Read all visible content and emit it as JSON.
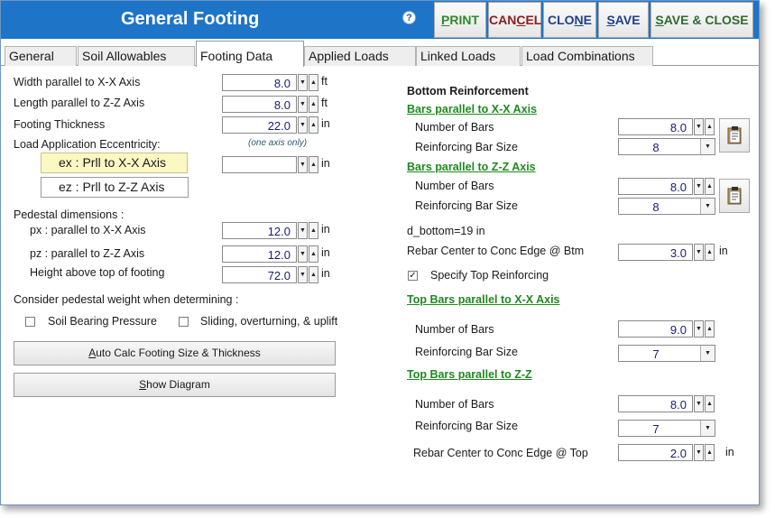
{
  "window": {
    "title": "General Footing",
    "help_glyph": "?",
    "buttons": {
      "print": {
        "pre": "",
        "u": "P",
        "post": "RINT"
      },
      "cancel": {
        "pre": "CAN",
        "u": "C",
        "post": "EL"
      },
      "clone": {
        "pre": "CLO",
        "u": "N",
        "post": "E"
      },
      "save": {
        "pre": "",
        "u": "S",
        "post": "AVE"
      },
      "save_close": {
        "pre": "",
        "u": "S",
        "post": "AVE & CLOSE"
      }
    }
  },
  "tabs": [
    "General",
    "Soil Allowables",
    "Footing Data",
    "Applied Loads",
    "Linked Loads",
    "Load Combinations"
  ],
  "left": {
    "width_label": "Width parallel to X-X Axis",
    "width_value": "8.0",
    "width_unit": "ft",
    "length_label": "Length parallel to Z-Z Axis",
    "length_value": "8.0",
    "length_unit": "ft",
    "thickness_label": "Footing Thickness",
    "thickness_value": "22.0",
    "thickness_unit": "in",
    "ecc_label": "Load Application Eccentricity:",
    "ecc_hint": "(one axis only)",
    "ex_button": "ex : Prll to X-X Axis",
    "ez_button": "ez : Prll to Z-Z Axis",
    "ecc_value": "",
    "ecc_unit": "in",
    "pedestal_label": "Pedestal dimensions :",
    "px_label": "px : parallel to X-X Axis",
    "px_value": "12.0",
    "px_unit": "in",
    "pz_label": "pz : parallel to Z-Z Axis",
    "pz_value": "12.0",
    "pz_unit": "in",
    "height_label": "Height above top of footing",
    "height_value": "72.0",
    "height_unit": "in",
    "ped_weight_label": "Consider pedestal weight when determining :",
    "soil_bearing_label": "Soil Bearing Pressure",
    "sliding_label": "Sliding, overturning, & uplift",
    "auto_calc": {
      "u": "A",
      "rest": "uto Calc Footing Size & Thickness"
    },
    "show_diagram": {
      "u": "S",
      "rest": "how Diagram"
    }
  },
  "right": {
    "bottom_title": "Bottom Reinforcement",
    "bars_x_title": "Bars parallel to X-X Axis",
    "bars_x_num_label": "Number of Bars",
    "bars_x_num_value": "8.0",
    "bars_x_size_label": "Reinforcing Bar Size",
    "bars_x_size_value": "8",
    "bars_z_title": "Bars parallel to Z-Z Axis",
    "bars_z_num_label": "Number of Bars",
    "bars_z_num_value": "8.0",
    "bars_z_size_label": "Reinforcing Bar Size",
    "bars_z_size_value": "8",
    "d_bottom": "d_bottom=19 in",
    "rebar_btm_label": "Rebar Center to Conc Edge @ Btm",
    "rebar_btm_value": "3.0",
    "rebar_btm_unit": "in",
    "specify_top_label": "Specify Top Reinforcing",
    "top_x_title": "Top Bars parallel to X-X Axis",
    "top_x_num_label": "Number of Bars",
    "top_x_num_value": "9.0",
    "top_x_size_label": "Reinforcing Bar Size",
    "top_x_size_value": "7",
    "top_z_title": "Top Bars parallel to Z-Z",
    "top_z_num_label": "Number of Bars",
    "top_z_num_value": "8.0",
    "top_z_size_label": "Reinforcing Bar Size",
    "top_z_size_value": "7",
    "rebar_top_label": "Rebar Center to Conc Edge @ Top",
    "rebar_top_value": "2.0",
    "rebar_top_unit": "in"
  },
  "glyphs": {
    "down": "▼",
    "up": "▲",
    "check": "✓"
  },
  "colors": {
    "titlebar": "#1e74c6",
    "link_green": "#1e8a1e",
    "value_text": "#1a1a7a",
    "highlight": "#fcf8c4"
  }
}
